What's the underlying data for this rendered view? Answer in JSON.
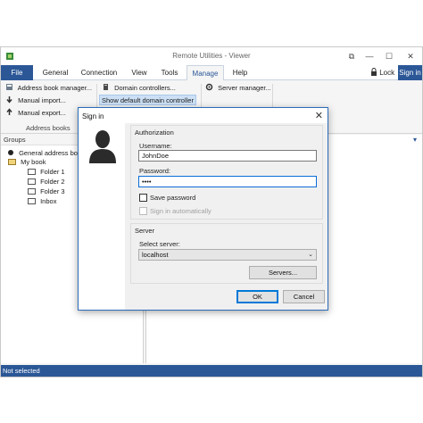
{
  "window": {
    "title": "Remote Utilities - Viewer",
    "controls": [
      "⧉",
      "—",
      "☐",
      "✕"
    ]
  },
  "tabs": {
    "file": "File",
    "general": "General",
    "connection": "Connection",
    "view": "View",
    "tools": "Tools",
    "manage": "Manage",
    "help": "Help",
    "lock": "Lock",
    "signin": "Sign in"
  },
  "ribbon": {
    "address_book_manager": "Address book manager...",
    "manual_import": "Manual import...",
    "manual_export": "Manual export...",
    "address_books_group": "Address books",
    "domain_controllers": "Domain controllers...",
    "show_default_dc": "Show default domain controller",
    "server_manager": "Server manager..."
  },
  "left_panel": {
    "header": "Groups",
    "items": [
      {
        "label": "General address book"
      },
      {
        "label": "My book"
      },
      {
        "label": "Folder 1"
      },
      {
        "label": "Folder 2"
      },
      {
        "label": "Folder 3"
      },
      {
        "label": "Inbox"
      }
    ]
  },
  "status": {
    "text": "Not selected"
  },
  "dialog": {
    "title": "Sign in",
    "close": "✕",
    "authorization_title": "Authorization",
    "username_label": "Username:",
    "username_value": "JohnDoe",
    "password_label": "Password:",
    "password_value": "••••",
    "save_password": "Save password",
    "sign_in_auto": "Sign in automatically",
    "server_title": "Server",
    "select_server_label": "Select server:",
    "server_value": "localhost",
    "servers_button": "Servers...",
    "ok_button": "OK",
    "cancel_button": "Cancel"
  },
  "colors": {
    "accent": "#2b5797",
    "dialog_border": "#2b6cb8",
    "focus": "#0b6cd8"
  }
}
